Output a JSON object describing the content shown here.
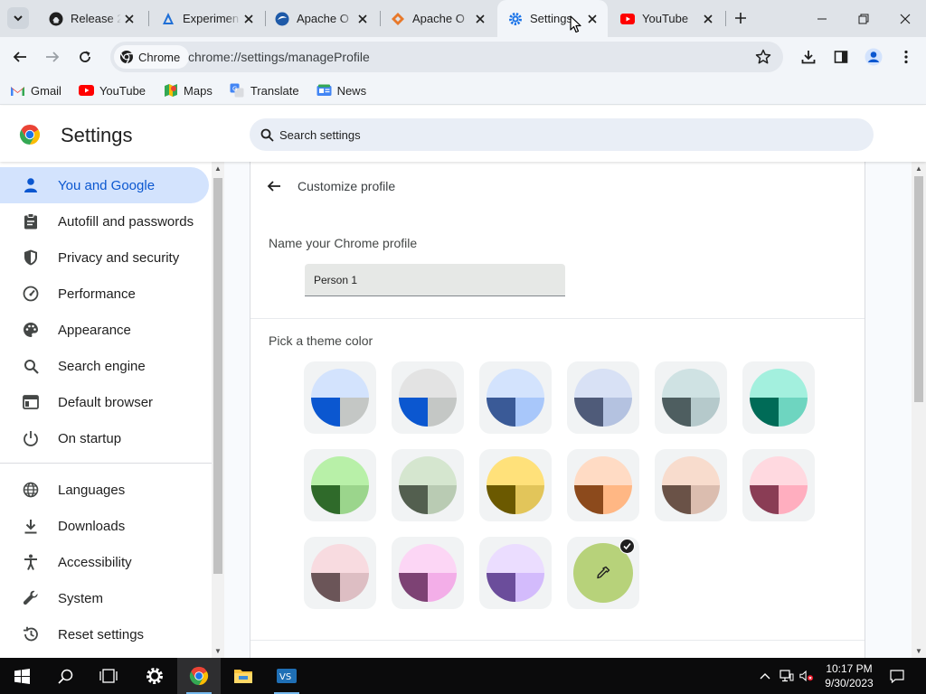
{
  "browser": {
    "tabs": [
      {
        "title": "Release 2.",
        "icon": "github-icon",
        "active": false
      },
      {
        "title": "Experimen",
        "icon": "azure-ml-icon",
        "active": false
      },
      {
        "title": "Apache O",
        "icon": "apache-icon",
        "active": false
      },
      {
        "title": "Apache O",
        "icon": "diamond-icon",
        "active": false
      },
      {
        "title": "Settings",
        "icon": "gear-icon",
        "active": true
      },
      {
        "title": "YouTube",
        "icon": "youtube-icon",
        "active": false
      }
    ],
    "omnibox": {
      "chip_label": "Chrome",
      "url": "chrome://settings/manageProfile"
    },
    "bookmarks": [
      {
        "label": "Gmail",
        "icon": "gmail-icon"
      },
      {
        "label": "YouTube",
        "icon": "youtube-icon"
      },
      {
        "label": "Maps",
        "icon": "maps-icon"
      },
      {
        "label": "Translate",
        "icon": "translate-icon"
      },
      {
        "label": "News",
        "icon": "news-icon"
      }
    ]
  },
  "settings": {
    "title": "Settings",
    "search_placeholder": "Search settings",
    "nav": [
      {
        "label": "You and Google",
        "icon": "person-icon",
        "active": true
      },
      {
        "label": "Autofill and passwords",
        "icon": "clipboard-icon",
        "active": false
      },
      {
        "label": "Privacy and security",
        "icon": "shield-icon",
        "active": false
      },
      {
        "label": "Performance",
        "icon": "speedometer-icon",
        "active": false
      },
      {
        "label": "Appearance",
        "icon": "palette-icon",
        "active": false
      },
      {
        "label": "Search engine",
        "icon": "search-icon",
        "active": false
      },
      {
        "label": "Default browser",
        "icon": "browser-window-icon",
        "active": false
      },
      {
        "label": "On startup",
        "icon": "power-icon",
        "active": false
      },
      {
        "label": "Languages",
        "icon": "globe-icon",
        "active": false
      },
      {
        "label": "Downloads",
        "icon": "download-icon",
        "active": false
      },
      {
        "label": "Accessibility",
        "icon": "accessibility-icon",
        "active": false
      },
      {
        "label": "System",
        "icon": "wrench-icon",
        "active": false
      },
      {
        "label": "Reset settings",
        "icon": "history-icon",
        "active": false
      }
    ]
  },
  "profile": {
    "header": "Customize profile",
    "name_label": "Name your Chrome profile",
    "name_value": "Person 1",
    "theme_label": "Pick a theme color",
    "themes": [
      {
        "top": "#d3e3fd",
        "left": "#0b57d0",
        "right": "#c4c7c5",
        "selected": false
      },
      {
        "top": "#e3e3e3",
        "left": "#0b57d0",
        "right": "#c4c7c5",
        "selected": false
      },
      {
        "top": "#d3e3fd",
        "left": "#3a5a97",
        "right": "#a8c7fa",
        "selected": false
      },
      {
        "top": "#d8e1f5",
        "left": "#4f5b79",
        "right": "#b4c2e0",
        "selected": false
      },
      {
        "top": "#cfe2e3",
        "left": "#4e5e60",
        "right": "#b5c9cb",
        "selected": false
      },
      {
        "top": "#a3f0de",
        "left": "#006b57",
        "right": "#6ed5c0",
        "selected": false
      },
      {
        "top": "#b8f0a8",
        "left": "#2f6a2a",
        "right": "#9bd58c",
        "selected": false
      },
      {
        "top": "#d5e6cf",
        "left": "#535f4f",
        "right": "#b9cbb3",
        "selected": false
      },
      {
        "top": "#ffe17a",
        "left": "#6b5900",
        "right": "#e2c55a",
        "selected": false
      },
      {
        "top": "#ffdbc4",
        "left": "#8c4a1c",
        "right": "#ffb784",
        "selected": false
      },
      {
        "top": "#f8dccd",
        "left": "#6a5247",
        "right": "#dbbdaf",
        "selected": false
      },
      {
        "top": "#ffd9e0",
        "left": "#8a3d55",
        "right": "#ffaebf",
        "selected": false
      },
      {
        "top": "#f8dbe0",
        "left": "#6b5558",
        "right": "#ddbec3",
        "selected": false
      },
      {
        "top": "#fcd6f5",
        "left": "#7d4274",
        "right": "#f3aee8",
        "selected": false
      },
      {
        "top": "#ebddff",
        "left": "#6b4d9b",
        "right": "#d3bbfc",
        "selected": false
      },
      {
        "custom": true,
        "color": "#b7d27a",
        "icon": "eyedropper-icon",
        "selected": true
      }
    ]
  },
  "taskbar": {
    "time": "10:17 PM",
    "date": "9/30/2023",
    "apps": [
      "windows-start-icon",
      "search-icon",
      "task-view-icon",
      "settings-gear-icon",
      "chrome-icon",
      "file-explorer-icon",
      "vscode-icon"
    ]
  }
}
